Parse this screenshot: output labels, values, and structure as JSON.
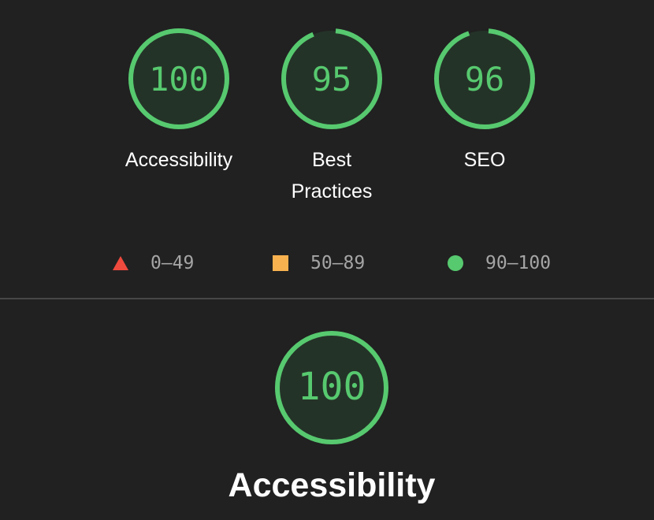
{
  "summary_gauges": [
    {
      "category": "Accessibility",
      "score": "100",
      "score_value": 100
    },
    {
      "category": "Best Practices",
      "score": "95",
      "score_value": 95
    },
    {
      "category": "SEO",
      "score": "96",
      "score_value": 96
    }
  ],
  "legend": [
    {
      "range": "0–49",
      "shape": "triangle",
      "color": "#ef4a3e"
    },
    {
      "range": "50–89",
      "shape": "square",
      "color": "#f7b14f"
    },
    {
      "range": "90–100",
      "shape": "circle",
      "color": "#57c96f"
    }
  ],
  "category_header": {
    "score": "100",
    "score_value": 100,
    "title": "Accessibility"
  },
  "colors": {
    "background": "#212121",
    "pass": "#57c96f",
    "gauge_fill": "#243328",
    "divider": "#474747",
    "legend_text": "#a5a5a5"
  }
}
